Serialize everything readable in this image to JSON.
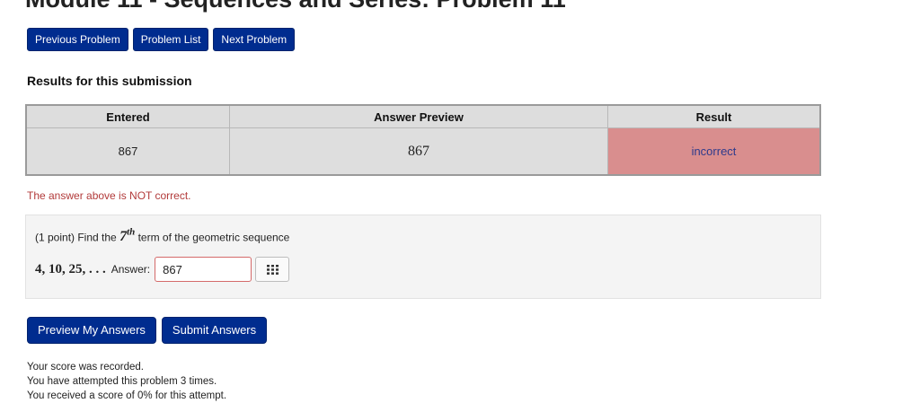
{
  "page": {
    "title": "Module 11 - Sequences and Series: Problem 11"
  },
  "nav": {
    "previous": "Previous Problem",
    "list": "Problem List",
    "next": "Next Problem"
  },
  "results": {
    "heading": "Results for this submission",
    "columns": [
      "Entered",
      "Answer Preview",
      "Result"
    ],
    "rows": [
      {
        "entered": "867",
        "preview": "867",
        "result": "incorrect"
      }
    ],
    "message": "The answer above is NOT correct."
  },
  "problem": {
    "points": "(1 point) Find the",
    "term_number": "7",
    "term_suffix": "th",
    "prompt_rest": "term of the geometric sequence",
    "sequence": "4, 10, 25, . . .",
    "answer_label": "Answer:",
    "answer_value": "867",
    "keypad_icon": "grid-keypad-icon"
  },
  "actions": {
    "preview": "Preview My Answers",
    "submit": "Submit Answers"
  },
  "score_notes": [
    "Your score was recorded.",
    "You have attempted this problem 3 times.",
    "You received a score of 0% for this attempt."
  ],
  "colors": {
    "button_bg": "#002c8f",
    "incorrect_cell": "#d98e8e",
    "error_text": "#b23a3a",
    "input_border": "#d46a6a"
  }
}
